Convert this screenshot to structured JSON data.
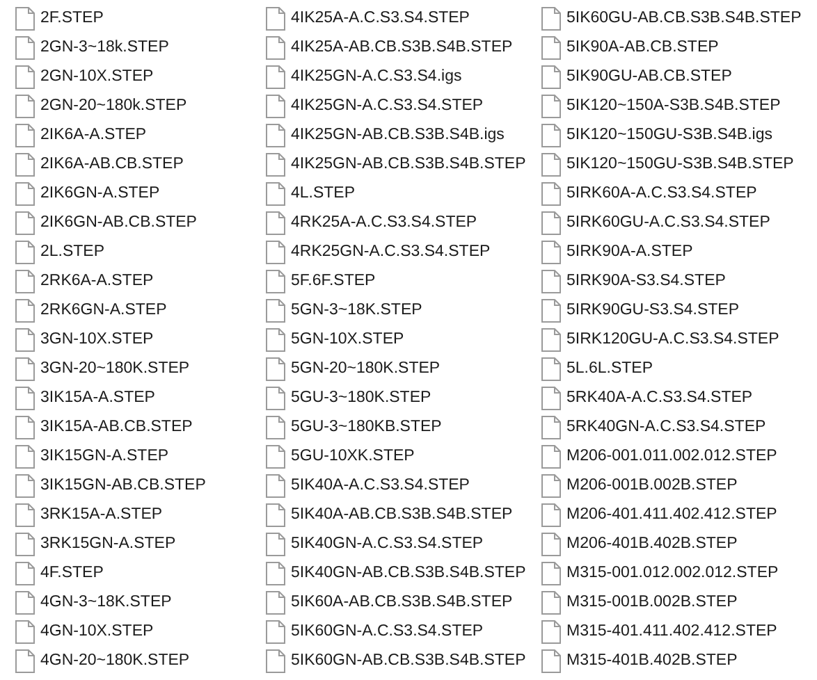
{
  "files": [
    {
      "name": "2F.STEP"
    },
    {
      "name": "2GN-3~18k.STEP"
    },
    {
      "name": "2GN-10X.STEP"
    },
    {
      "name": "2GN-20~180k.STEP"
    },
    {
      "name": "2IK6A-A.STEP"
    },
    {
      "name": "2IK6A-AB.CB.STEP"
    },
    {
      "name": "2IK6GN-A.STEP"
    },
    {
      "name": "2IK6GN-AB.CB.STEP"
    },
    {
      "name": "2L.STEP"
    },
    {
      "name": "2RK6A-A.STEP"
    },
    {
      "name": "2RK6GN-A.STEP"
    },
    {
      "name": "3GN-10X.STEP"
    },
    {
      "name": "3GN-20~180K.STEP"
    },
    {
      "name": "3IK15A-A.STEP"
    },
    {
      "name": "3IK15A-AB.CB.STEP"
    },
    {
      "name": "3IK15GN-A.STEP"
    },
    {
      "name": "3IK15GN-AB.CB.STEP"
    },
    {
      "name": "3RK15A-A.STEP"
    },
    {
      "name": "3RK15GN-A.STEP"
    },
    {
      "name": "4F.STEP"
    },
    {
      "name": "4GN-3~18K.STEP"
    },
    {
      "name": "4GN-10X.STEP"
    },
    {
      "name": "4GN-20~180K.STEP"
    },
    {
      "name": "4IK25A-A.C.S3.S4.STEP"
    },
    {
      "name": "4IK25A-AB.CB.S3B.S4B.STEP"
    },
    {
      "name": "4IK25GN-A.C.S3.S4.igs"
    },
    {
      "name": "4IK25GN-A.C.S3.S4.STEP"
    },
    {
      "name": "4IK25GN-AB.CB.S3B.S4B.igs"
    },
    {
      "name": "4IK25GN-AB.CB.S3B.S4B.STEP"
    },
    {
      "name": "4L.STEP"
    },
    {
      "name": "4RK25A-A.C.S3.S4.STEP"
    },
    {
      "name": "4RK25GN-A.C.S3.S4.STEP"
    },
    {
      "name": "5F.6F.STEP"
    },
    {
      "name": "5GN-3~18K.STEP"
    },
    {
      "name": "5GN-10X.STEP"
    },
    {
      "name": "5GN-20~180K.STEP"
    },
    {
      "name": "5GU-3~180K.STEP"
    },
    {
      "name": "5GU-3~180KB.STEP"
    },
    {
      "name": "5GU-10XK.STEP"
    },
    {
      "name": "5IK40A-A.C.S3.S4.STEP"
    },
    {
      "name": "5IK40A-AB.CB.S3B.S4B.STEP"
    },
    {
      "name": "5IK40GN-A.C.S3.S4.STEP"
    },
    {
      "name": "5IK40GN-AB.CB.S3B.S4B.STEP"
    },
    {
      "name": "5IK60A-AB.CB.S3B.S4B.STEP"
    },
    {
      "name": "5IK60GN-A.C.S3.S4.STEP"
    },
    {
      "name": "5IK60GN-AB.CB.S3B.S4B.STEP"
    },
    {
      "name": "5IK60GU-AB.CB.S3B.S4B.STEP"
    },
    {
      "name": "5IK90A-AB.CB.STEP"
    },
    {
      "name": "5IK90GU-AB.CB.STEP"
    },
    {
      "name": "5IK120~150A-S3B.S4B.STEP"
    },
    {
      "name": "5IK120~150GU-S3B.S4B.igs"
    },
    {
      "name": "5IK120~150GU-S3B.S4B.STEP"
    },
    {
      "name": "5IRK60A-A.C.S3.S4.STEP"
    },
    {
      "name": "5IRK60GU-A.C.S3.S4.STEP"
    },
    {
      "name": "5IRK90A-A.STEP"
    },
    {
      "name": "5IRK90A-S3.S4.STEP"
    },
    {
      "name": "5IRK90GU-S3.S4.STEP"
    },
    {
      "name": "5IRK120GU-A.C.S3.S4.STEP"
    },
    {
      "name": "5L.6L.STEP"
    },
    {
      "name": "5RK40A-A.C.S3.S4.STEP"
    },
    {
      "name": "5RK40GN-A.C.S3.S4.STEP"
    },
    {
      "name": "M206-001.011.002.012.STEP"
    },
    {
      "name": "M206-001B.002B.STEP"
    },
    {
      "name": "M206-401.411.402.412.STEP"
    },
    {
      "name": "M206-401B.402B.STEP"
    },
    {
      "name": "M315-001.012.002.012.STEP"
    },
    {
      "name": "M315-001B.002B.STEP"
    },
    {
      "name": "M315-401.411.402.412.STEP"
    },
    {
      "name": "M315-401B.402B.STEP"
    }
  ]
}
